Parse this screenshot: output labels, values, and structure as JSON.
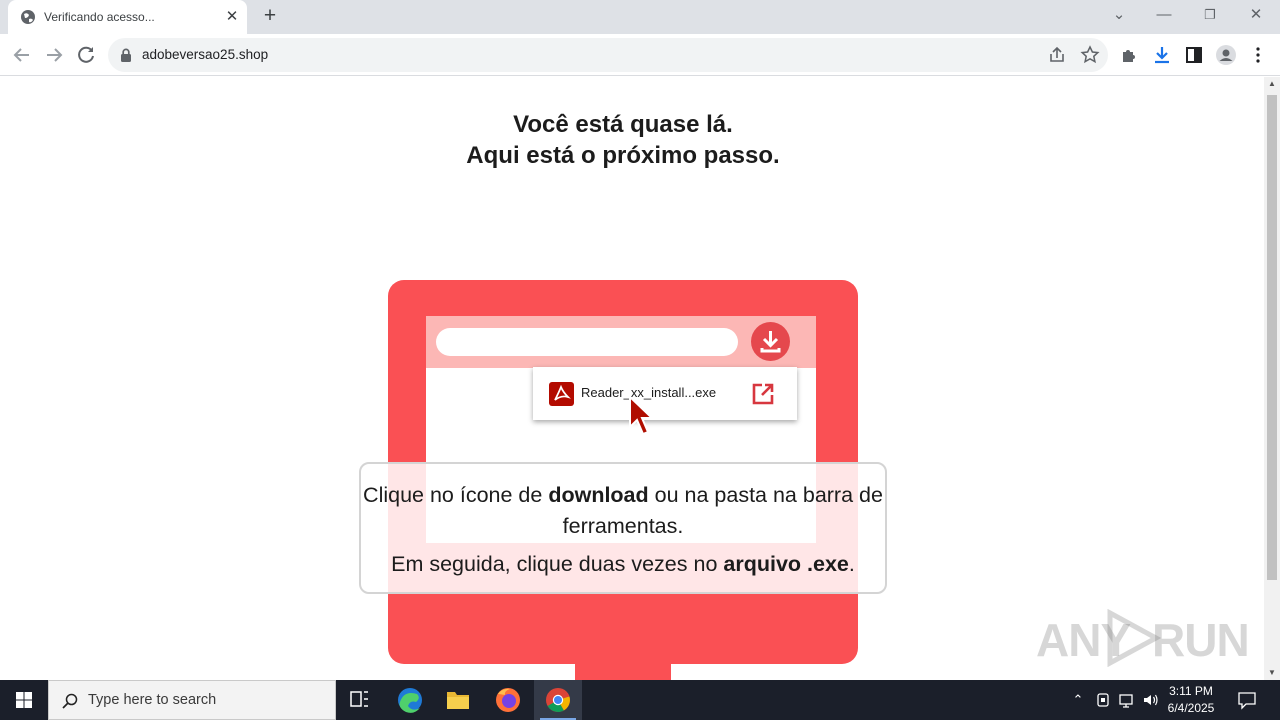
{
  "browser": {
    "tab_title": "Verificando acesso...",
    "tab_close": "✕",
    "new_tab": "+",
    "url": "adobeversao25.shop",
    "window_controls": {
      "minimize": "—",
      "restore": "❐",
      "close": "✕",
      "tab_search": "⌄"
    }
  },
  "page": {
    "headline_line1": "Você está quase lá.",
    "headline_line2": "Aqui está o próximo passo.",
    "popup_file": "Reader_xx_install...exe",
    "instr_pre": "Clique no ícone de ",
    "instr_bold1": "download",
    "instr_mid": " ou na pasta na barra de ferramentas.",
    "instr2_pre": "Em seguida, clique duas vezes no ",
    "instr2_bold": "arquivo .exe",
    "instr2_post": ".",
    "accent_color": "#fa5054"
  },
  "watermark": {
    "left": "ANY",
    "right": "RUN"
  },
  "taskbar": {
    "search_placeholder": "Type here to search",
    "time": "3:11 PM",
    "date": "6/4/2025"
  }
}
